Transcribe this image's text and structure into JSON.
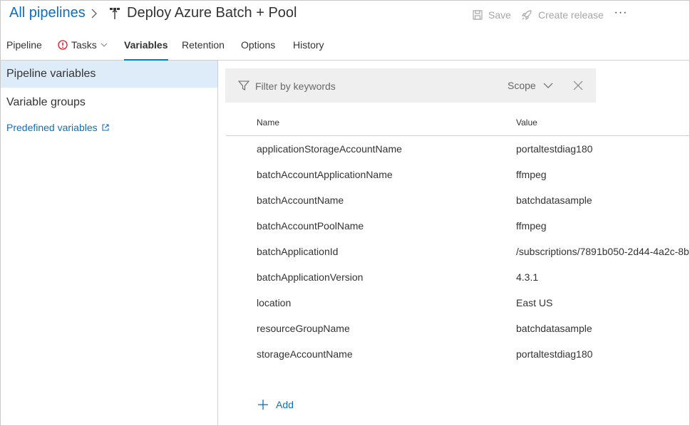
{
  "header": {
    "breadcrumb_root": "All pipelines",
    "pipeline_title": "Deploy Azure Batch + Pool",
    "save_label": "Save",
    "create_release_label": "Create release",
    "more_label": "···"
  },
  "tabs": [
    {
      "label": "Pipeline"
    },
    {
      "label": "Tasks"
    },
    {
      "label": "Variables"
    },
    {
      "label": "Retention"
    },
    {
      "label": "Options"
    },
    {
      "label": "History"
    }
  ],
  "sidebar": {
    "items": [
      {
        "label": "Pipeline variables"
      },
      {
        "label": "Variable groups"
      }
    ],
    "predefined_link": "Predefined variables"
  },
  "filter": {
    "placeholder": "Filter by keywords",
    "scope_label": "Scope"
  },
  "table": {
    "columns": {
      "name": "Name",
      "value": "Value"
    },
    "rows": [
      {
        "name": "applicationStorageAccountName",
        "value": "portaltestdiag180"
      },
      {
        "name": "batchAccountApplicationName",
        "value": "ffmpeg"
      },
      {
        "name": "batchAccountName",
        "value": "batchdatasample"
      },
      {
        "name": "batchAccountPoolName",
        "value": "ffmpeg"
      },
      {
        "name": "batchApplicationId",
        "value": "/subscriptions/7891b050-2d44-4a2c-8b"
      },
      {
        "name": "batchApplicationVersion",
        "value": "4.3.1"
      },
      {
        "name": "location",
        "value": "East US"
      },
      {
        "name": "resourceGroupName",
        "value": "batchdatasample"
      },
      {
        "name": "storageAccountName",
        "value": "portaltestdiag180"
      }
    ]
  },
  "add_label": "Add",
  "colors": {
    "accent": "#0078d4",
    "link": "#106ebe",
    "selected_bg": "#deecf9",
    "warning": "#e81123",
    "disabled": "#a6a6a6"
  },
  "icons": {
    "breadcrumb_separator": "chevron-right-icon",
    "pipeline": "pipeline-icon",
    "save": "save-icon",
    "release": "rocket-icon",
    "tasks_warning": "error-circle-icon",
    "tasks_dropdown": "chevron-down-icon",
    "external_link": "external-link-icon",
    "filter": "filter-icon",
    "scope_dropdown": "chevron-down-icon",
    "clear": "close-icon",
    "add": "plus-icon"
  }
}
